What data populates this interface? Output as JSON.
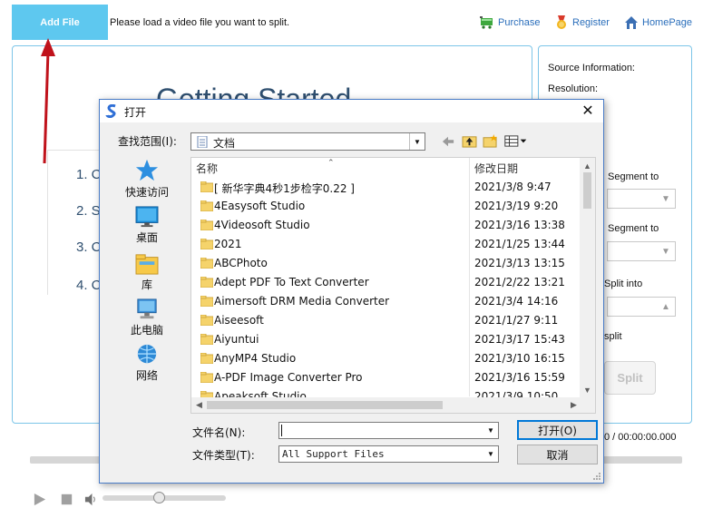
{
  "app": {
    "add_file_label": "Add File",
    "hint": "Please load a video file you want to split.",
    "links": [
      {
        "label": "Purchase",
        "icon": "cart-icon"
      },
      {
        "label": "Register",
        "icon": "medal-icon"
      },
      {
        "label": "HomePage",
        "icon": "home-icon"
      }
    ],
    "main": {
      "heading": "Getting Started",
      "steps": [
        "1. C",
        "2. S",
        "3. C",
        "4. C"
      ]
    },
    "side": {
      "source_info": "Source Information:",
      "resolution": "Resolution:",
      "segment_to_1": "Segment to",
      "segment_to_2": "Segment to",
      "split_into": "Split into",
      "split_label": "split",
      "split_button": "Split"
    },
    "time": "0 / 00:00:00.000",
    "volume_level": 0.46,
    "colors": {
      "accent": "#5ec8ef",
      "border": "#7cc5e8",
      "link": "#2a6ebb",
      "arrow": "#c0121b"
    }
  },
  "dialog": {
    "title": "打开",
    "look_in_label": "查找范围(I):",
    "look_in_value": "文档",
    "places": [
      {
        "label": "快速访问",
        "icon": "star-icon"
      },
      {
        "label": "桌面",
        "icon": "desktop-icon"
      },
      {
        "label": "库",
        "icon": "library-icon"
      },
      {
        "label": "此电脑",
        "icon": "computer-icon"
      },
      {
        "label": "网络",
        "icon": "network-icon"
      }
    ],
    "columns": {
      "name": "名称",
      "modified": "修改日期"
    },
    "files": [
      {
        "name": "[ 新华字典4秒1步检字0.22 ]",
        "date": "2021/3/8 9:47"
      },
      {
        "name": "4Easysoft Studio",
        "date": "2021/3/19 9:20"
      },
      {
        "name": "4Videosoft Studio",
        "date": "2021/3/16 13:38"
      },
      {
        "name": "2021",
        "date": "2021/1/25 13:44"
      },
      {
        "name": "ABCPhoto",
        "date": "2021/3/13 13:15"
      },
      {
        "name": "Adept PDF To Text Converter",
        "date": "2021/2/22 13:21"
      },
      {
        "name": "Aimersoft DRM Media Converter",
        "date": "2021/3/4 14:16"
      },
      {
        "name": "Aiseesoft",
        "date": "2021/1/27 9:11"
      },
      {
        "name": "Aiyuntui",
        "date": "2021/3/17 15:43"
      },
      {
        "name": "AnyMP4 Studio",
        "date": "2021/3/10 16:15"
      },
      {
        "name": "A-PDF Image Converter Pro",
        "date": "2021/3/16 15:59"
      },
      {
        "name": "Apeaksoft Studio",
        "date": "2021/3/9 10:50"
      }
    ],
    "filename_label": "文件名(N):",
    "filename_value": "",
    "filetype_label": "文件类型(T):",
    "filetype_value": "All Support Files",
    "open_button": "打开(O)",
    "cancel_button": "取消"
  }
}
